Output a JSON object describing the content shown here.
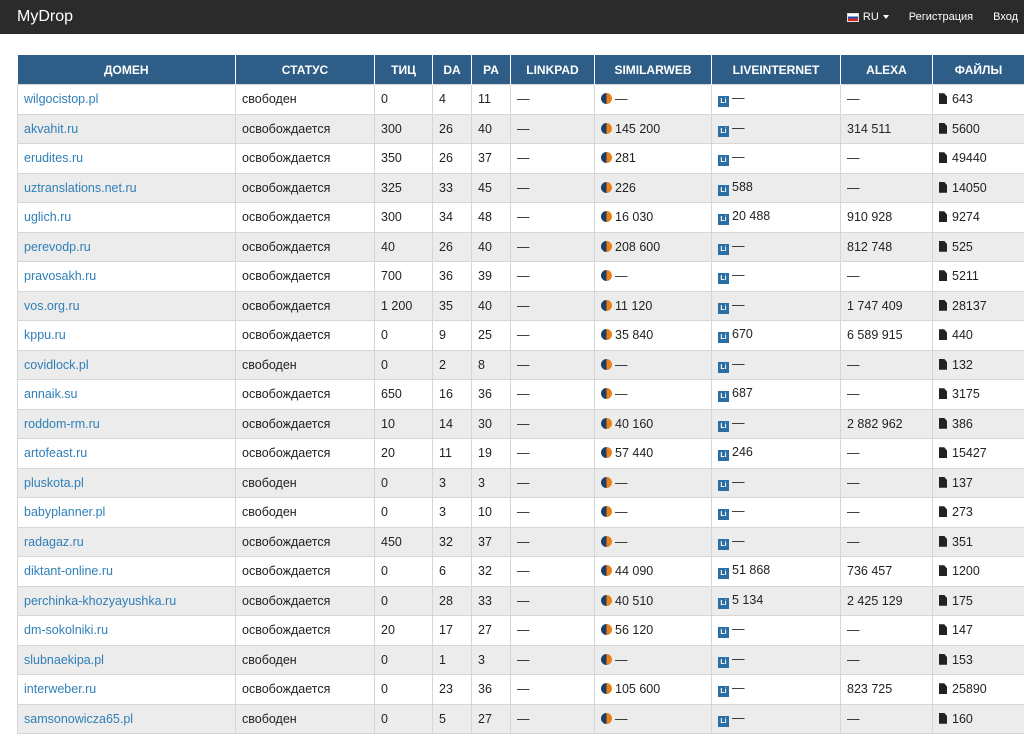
{
  "nav": {
    "brand": "MyDrop",
    "lang": "RU",
    "register": "Регистрация",
    "login": "Вход"
  },
  "table": {
    "headers": [
      "ДОМЕН",
      "СТАТУС",
      "ТИЦ",
      "DA",
      "PA",
      "LINKPAD",
      "SIMILARWEB",
      "LIVEINTERNET",
      "ALEXA",
      "ФАЙЛЫ"
    ],
    "rows": [
      [
        "wilgocistop.pl",
        "свободен",
        "0",
        "4",
        "11",
        "—",
        "—",
        "—",
        "—",
        "643"
      ],
      [
        "akvahit.ru",
        "освобождается",
        "300",
        "26",
        "40",
        "—",
        "145 200",
        "—",
        "314 511",
        "5600"
      ],
      [
        "erudites.ru",
        "освобождается",
        "350",
        "26",
        "37",
        "—",
        "281",
        "—",
        "—",
        "49440"
      ],
      [
        "uztranslations.net.ru",
        "освобождается",
        "325",
        "33",
        "45",
        "—",
        "226",
        "588",
        "—",
        "14050"
      ],
      [
        "uglich.ru",
        "освобождается",
        "300",
        "34",
        "48",
        "—",
        "16 030",
        "20 488",
        "910 928",
        "9274"
      ],
      [
        "perevodp.ru",
        "освобождается",
        "40",
        "26",
        "40",
        "—",
        "208 600",
        "—",
        "812 748",
        "525"
      ],
      [
        "pravosakh.ru",
        "освобождается",
        "700",
        "36",
        "39",
        "—",
        "—",
        "—",
        "—",
        "5211"
      ],
      [
        "vos.org.ru",
        "освобождается",
        "1 200",
        "35",
        "40",
        "—",
        "11 120",
        "—",
        "1 747 409",
        "28137"
      ],
      [
        "kppu.ru",
        "освобождается",
        "0",
        "9",
        "25",
        "—",
        "35 840",
        "670",
        "6 589 915",
        "440"
      ],
      [
        "covidlock.pl",
        "свободен",
        "0",
        "2",
        "8",
        "—",
        "—",
        "—",
        "—",
        "132"
      ],
      [
        "annaik.su",
        "освобождается",
        "650",
        "16",
        "36",
        "—",
        "—",
        "687",
        "—",
        "3175"
      ],
      [
        "roddom-rm.ru",
        "освобождается",
        "10",
        "14",
        "30",
        "—",
        "40 160",
        "—",
        "2 882 962",
        "386"
      ],
      [
        "artofeast.ru",
        "освобождается",
        "20",
        "11",
        "19",
        "—",
        "57 440",
        "246",
        "—",
        "15427"
      ],
      [
        "pluskota.pl",
        "свободен",
        "0",
        "3",
        "3",
        "—",
        "—",
        "—",
        "—",
        "137"
      ],
      [
        "babyplanner.pl",
        "свободен",
        "0",
        "3",
        "10",
        "—",
        "—",
        "—",
        "—",
        "273"
      ],
      [
        "radagaz.ru",
        "освобождается",
        "450",
        "32",
        "37",
        "—",
        "—",
        "—",
        "—",
        "351"
      ],
      [
        "diktant-online.ru",
        "освобождается",
        "0",
        "6",
        "32",
        "—",
        "44 090",
        "51 868",
        "736 457",
        "1200"
      ],
      [
        "perchinka-khozyayushka.ru",
        "освобождается",
        "0",
        "28",
        "33",
        "—",
        "40 510",
        "5 134",
        "2 425 129",
        "175"
      ],
      [
        "dm-sokolniki.ru",
        "освобождается",
        "20",
        "17",
        "27",
        "—",
        "56 120",
        "—",
        "—",
        "147"
      ],
      [
        "slubnaekipa.pl",
        "свободен",
        "0",
        "1",
        "3",
        "—",
        "—",
        "—",
        "—",
        "153"
      ],
      [
        "interweber.ru",
        "освобождается",
        "0",
        "23",
        "36",
        "—",
        "105 600",
        "—",
        "823 725",
        "25890"
      ],
      [
        "samsonowicza65.pl",
        "свободен",
        "0",
        "5",
        "27",
        "—",
        "—",
        "—",
        "—",
        "160"
      ]
    ]
  },
  "colors": {
    "navbar": "#2b2b2b",
    "header": "#2e5e87",
    "link": "#2f7fb8",
    "stripe": "#ececec"
  }
}
